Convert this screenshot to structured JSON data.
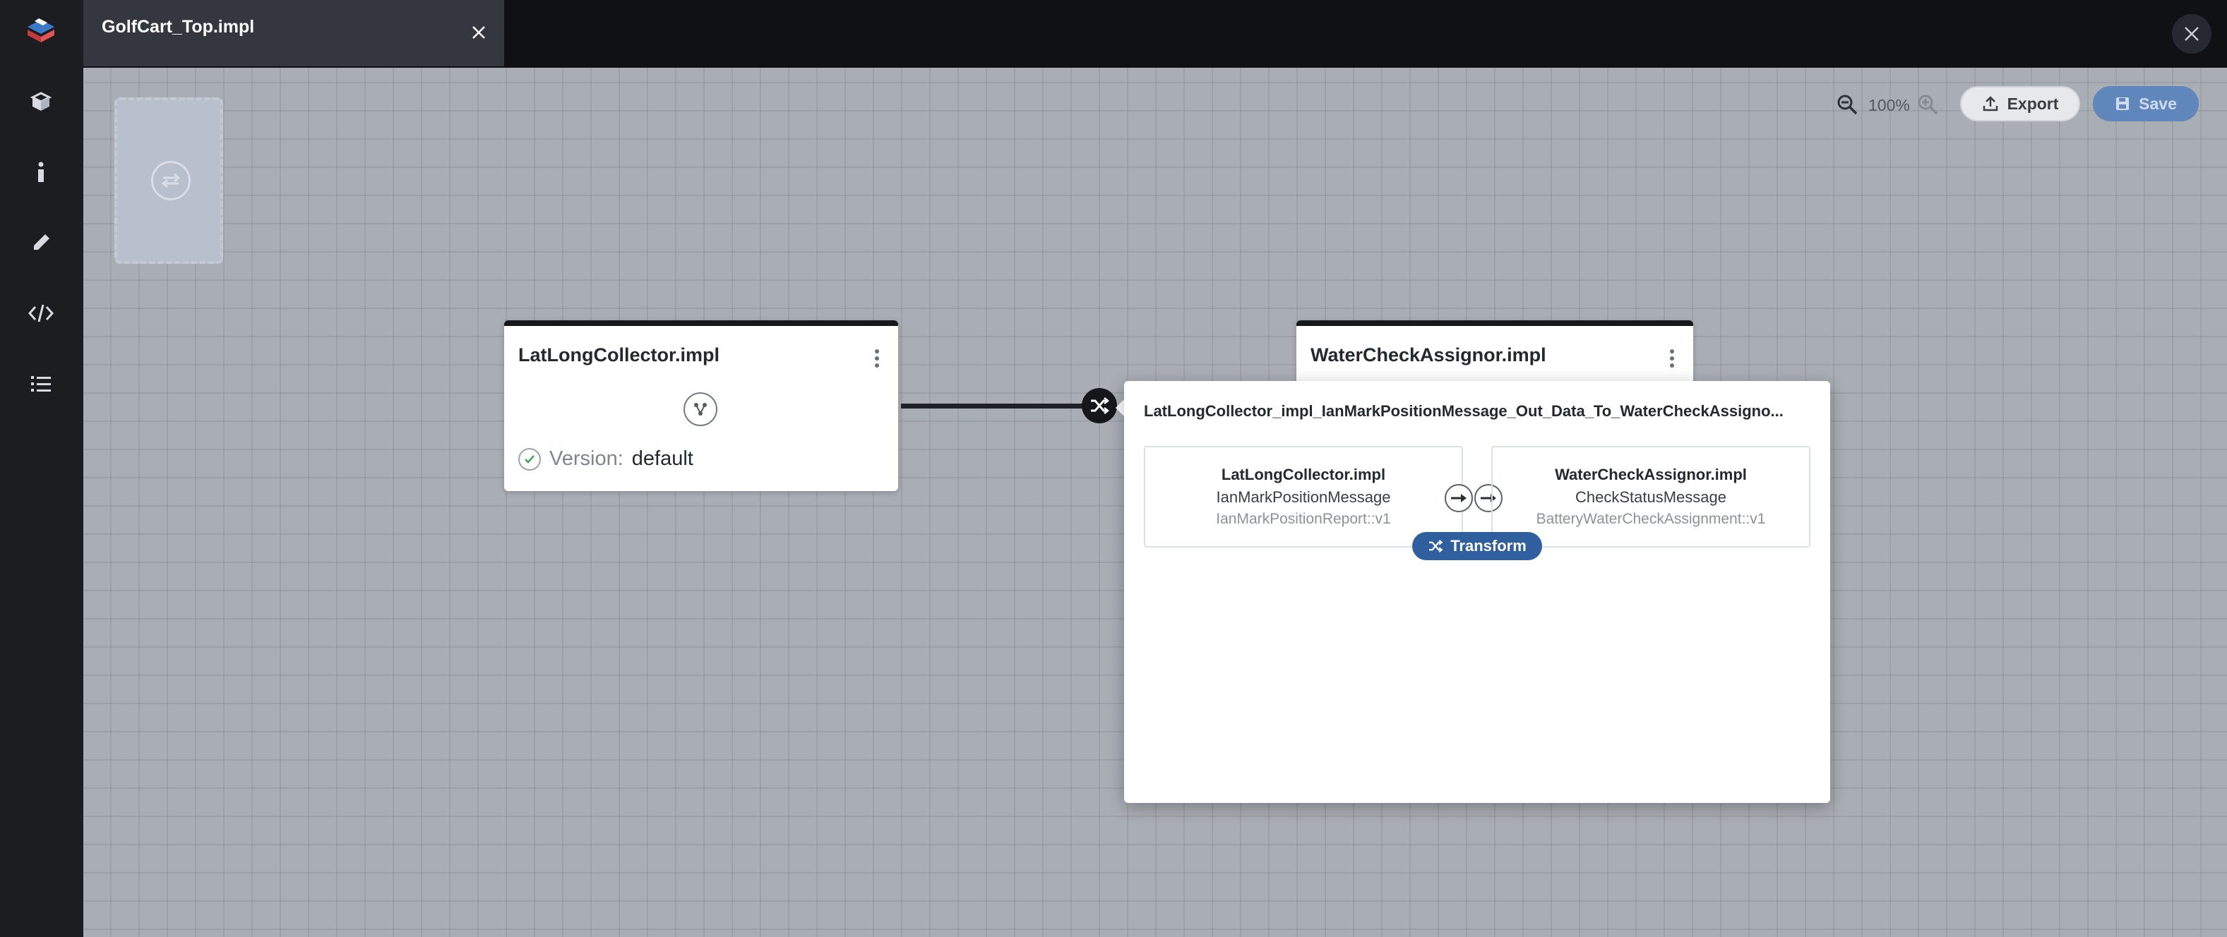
{
  "tab": {
    "title": "GolfCart_Top.impl"
  },
  "toolbar": {
    "zoom_level": "100%",
    "export_label": "Export",
    "save_label": "Save"
  },
  "nodes": [
    {
      "title": "LatLongCollector.impl",
      "version_label": "Version:",
      "version_value": "default"
    },
    {
      "title": "WaterCheckAssignor.impl"
    }
  ],
  "connection_popup": {
    "title": "LatLongCollector_impl_IanMarkPositionMessage_Out_Data_To_WaterCheckAssigno...",
    "source": {
      "component": "LatLongCollector.impl",
      "message": "IanMarkPositionMessage",
      "type": "IanMarkPositionReport::v1"
    },
    "target": {
      "component": "WaterCheckAssignor.impl",
      "message": "CheckStatusMessage",
      "type": "BatteryWaterCheckAssignment::v1"
    },
    "transform_label": "Transform"
  },
  "sidebar_icons": [
    "logo-icon",
    "package-icon",
    "info-icon",
    "pencil-icon",
    "code-icon",
    "checklist-icon"
  ],
  "colors": {
    "sidebar": "#1b1d21",
    "topbar": "#0f1115",
    "canvas": "#a9adb4",
    "primary": "#2f5f9e",
    "save_disabled": "#5f87bc"
  }
}
